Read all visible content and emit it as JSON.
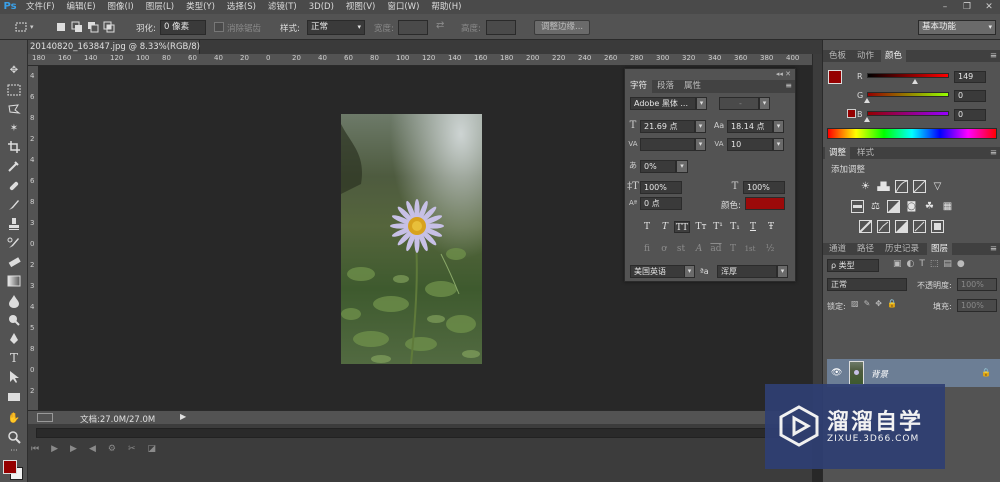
{
  "app": {
    "logo": "Ps"
  },
  "menu": [
    "文件(F)",
    "编辑(E)",
    "图像(I)",
    "图层(L)",
    "类型(Y)",
    "选择(S)",
    "滤镜(T)",
    "3D(D)",
    "视图(V)",
    "窗口(W)",
    "帮助(H)"
  ],
  "window_controls": {
    "minimize": "–",
    "restore": "❐",
    "close": "✕"
  },
  "options": {
    "feather_label": "羽化:",
    "feather_value": "0 像素",
    "antialias_label": "消除锯齿",
    "style_label": "样式:",
    "style_value": "正常",
    "width_label": "宽度:",
    "height_label": "高度:",
    "refine_edge": "调整边缘...",
    "workspace": "基本功能"
  },
  "document": {
    "tab_title": "20140820_163847.jpg @ 8.33%(RGB/8)",
    "tab_close": "✕",
    "status": "文档:27.0M/27.0M",
    "zoom": "8.33%"
  },
  "ruler_h": [
    "180",
    "160",
    "140",
    "120",
    "100",
    "80",
    "60",
    "40",
    "20",
    "0",
    "20",
    "40",
    "60",
    "80",
    "100",
    "120",
    "140",
    "160",
    "180",
    "200",
    "220",
    "240",
    "260",
    "280",
    "300",
    "320",
    "340",
    "360",
    "380",
    "400"
  ],
  "ruler_v": [
    "4",
    "6",
    "8",
    "2",
    "4",
    "6",
    "8",
    "3",
    "0",
    "2",
    "3",
    "4",
    "5",
    "8",
    "0",
    "2"
  ],
  "character_panel": {
    "tabs": [
      "字符",
      "段落",
      "属性"
    ],
    "font_family": "Adobe 黑体 ...",
    "font_style": "-",
    "font_size": "21.69 点",
    "leading": "18.14 点",
    "kerning": "",
    "tracking": "10",
    "tsume": "0%",
    "vertical_scale": "100%",
    "horizontal_scale": "100%",
    "baseline_shift": "0 点",
    "color_label": "颜色:",
    "text_color": "#9c0a0a",
    "style_buttons": [
      "T",
      "T",
      "TT",
      "Tт",
      "T¹",
      "T₁",
      "T",
      "Ŧ"
    ],
    "opentype_buttons": [
      "fi",
      "ơ",
      "st",
      "A",
      "ad",
      "T",
      "1st",
      "½"
    ],
    "language": "美国英语",
    "aa_label": "ªa",
    "antialias": "浑厚"
  },
  "color_panel": {
    "tabs": [
      "色板",
      "动作",
      "颜色"
    ],
    "r_label": "R",
    "g_label": "G",
    "b_label": "B",
    "r": "149",
    "g": "0",
    "b": "0",
    "fg_color": "#950000",
    "r_level": 0.58,
    "g_level": 0,
    "b_level": 0
  },
  "adjustments_panel": {
    "tabs": [
      "调整",
      "样式"
    ],
    "title": "添加调整"
  },
  "layers_panel": {
    "tabs": [
      "通道",
      "路径",
      "历史记录",
      "图层"
    ],
    "filter_kind": "ρ 类型",
    "blend_mode": "正常",
    "opacity_label": "不透明度:",
    "opacity": "100%",
    "lock_label": "锁定:",
    "fill_label": "填充:",
    "fill": "100%",
    "layers": [
      {
        "name": "背景",
        "visible": true,
        "locked": true
      }
    ]
  },
  "watermark": {
    "title": "溜溜自学",
    "url": "ZIXUE.3D66.COM"
  }
}
